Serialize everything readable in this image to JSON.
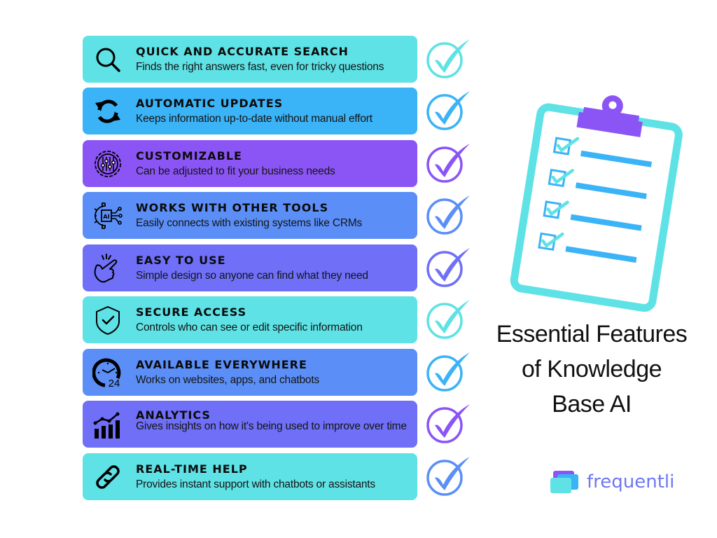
{
  "colors": {
    "cyan": "#5ee2e5",
    "sky": "#3bb3f7",
    "purple": "#8b55f5",
    "blue": "#5b8ff7",
    "indigo": "#6f6ff8",
    "clipboard_frame": "#5ee2e5",
    "clipboard_clip": "#8b55f5",
    "clipboard_lines": "#3bb3f7",
    "brand_text": "#6e78f2"
  },
  "features": [
    {
      "title": "QUICK AND ACCURATE SEARCH",
      "description": "Finds the right answers fast, even for tricky questions",
      "icon": "search-icon",
      "bg": "#5ee2e5",
      "check_color": "#5ee2e5"
    },
    {
      "title": "AUTOMATIC UPDATES",
      "description": "Keeps information up-to-date without manual effort",
      "icon": "refresh-icon",
      "bg": "#3bb3f7",
      "check_color": "#3bb3f7"
    },
    {
      "title": "CUSTOMIZABLE",
      "description": "Can be adjusted to fit your business needs",
      "icon": "settings-sliders-icon",
      "bg": "#8b55f5",
      "check_color": "#8b55f5"
    },
    {
      "title": "WORKS WITH OTHER TOOLS",
      "description": "Easily connects with existing systems like CRMs",
      "icon": "ai-integration-icon",
      "bg": "#5b8ff7",
      "check_color": "#5b8ff7"
    },
    {
      "title": "EASY TO USE",
      "description": "Simple design so anyone can find what they need",
      "icon": "snap-fingers-icon",
      "bg": "#6f6ff8",
      "check_color": "#6f6ff8"
    },
    {
      "title": "SECURE ACCESS",
      "description": "Controls who can see or edit specific information",
      "icon": "shield-check-icon",
      "bg": "#5ee2e5",
      "check_color": "#5ee2e5"
    },
    {
      "title": "AVAILABLE EVERYWHERE",
      "description": "Works on websites, apps, and chatbots",
      "icon": "clock-24-icon",
      "bg": "#5b8ff7",
      "check_color": "#3bb3f7"
    },
    {
      "title": "ANALYTICS",
      "description": "Gives insights on how it's being used to improve over time",
      "icon": "analytics-chart-icon",
      "bg": "#6f6ff8",
      "check_color": "#8b55f5"
    },
    {
      "title": "REAL-TIME HELP",
      "description": "Provides instant support with chatbots or assistants",
      "icon": "link-icon",
      "bg": "#5ee2e5",
      "check_color": "#5b8ff7"
    }
  ],
  "clock_label": "24",
  "ai_chip_label": "AI",
  "headline": {
    "line1": "Essential Features",
    "line2": "of Knowledge",
    "line3": "Base AI"
  },
  "brand": {
    "name": "frequentli"
  }
}
